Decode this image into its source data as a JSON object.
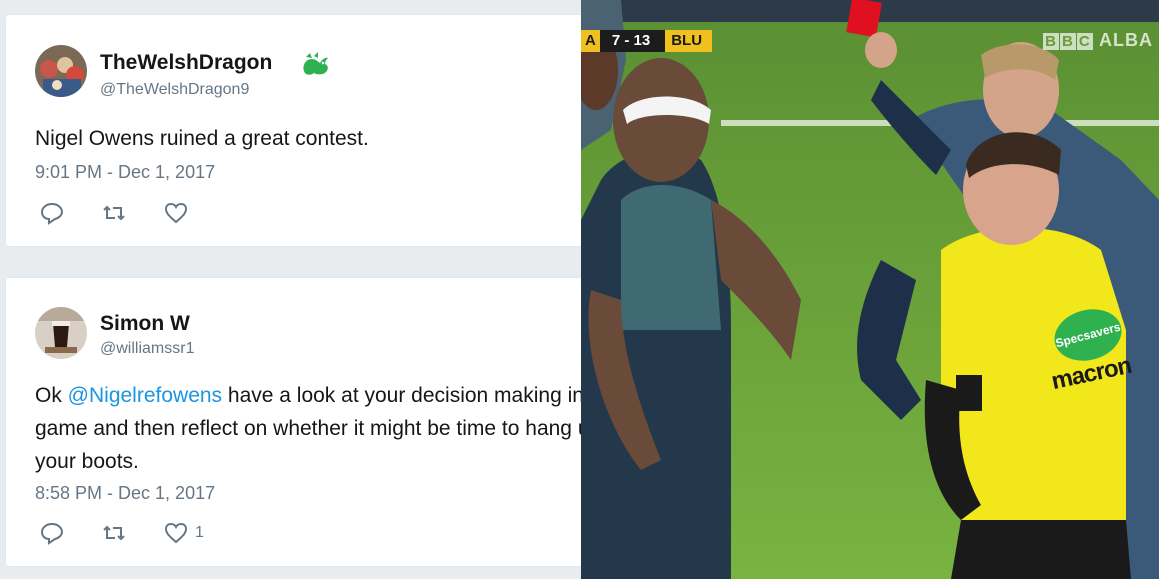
{
  "tweets": [
    {
      "name": "TheWelshDragon",
      "handle": "@TheWelshDragon9",
      "text": "Nigel Owens ruined a great contest.",
      "time": "9:01 PM - Dec 1, 2017",
      "likes": ""
    },
    {
      "name": "Simon W",
      "handle": "@williamssr1",
      "text_prefix": "Ok ",
      "mention": "@Nigelrefowens",
      "text_line1_rest": " have a look at your decision making in that",
      "text_line2": "game and then reflect on whether it might be time to hang up",
      "text_line3": "your boots.",
      "time": "8:58 PM - Dec 1, 2017",
      "likes": "1"
    }
  ],
  "photo": {
    "scoreboard": {
      "team_a": "A",
      "score": "7 - 13",
      "team_b": "BLU"
    },
    "broadcaster": {
      "boxes": [
        "B",
        "B",
        "C"
      ],
      "suffix": "ALBA"
    },
    "sponsor_badge": "Specsavers",
    "sponsor_text": "macron"
  },
  "colors": {
    "mention": "#1b95e0",
    "secondary_text": "#657786",
    "badge_green": "#2fb14f",
    "pitch_green": "#6b9b3a",
    "referee_yellow": "#f2e71a",
    "red_card": "#e01020"
  }
}
